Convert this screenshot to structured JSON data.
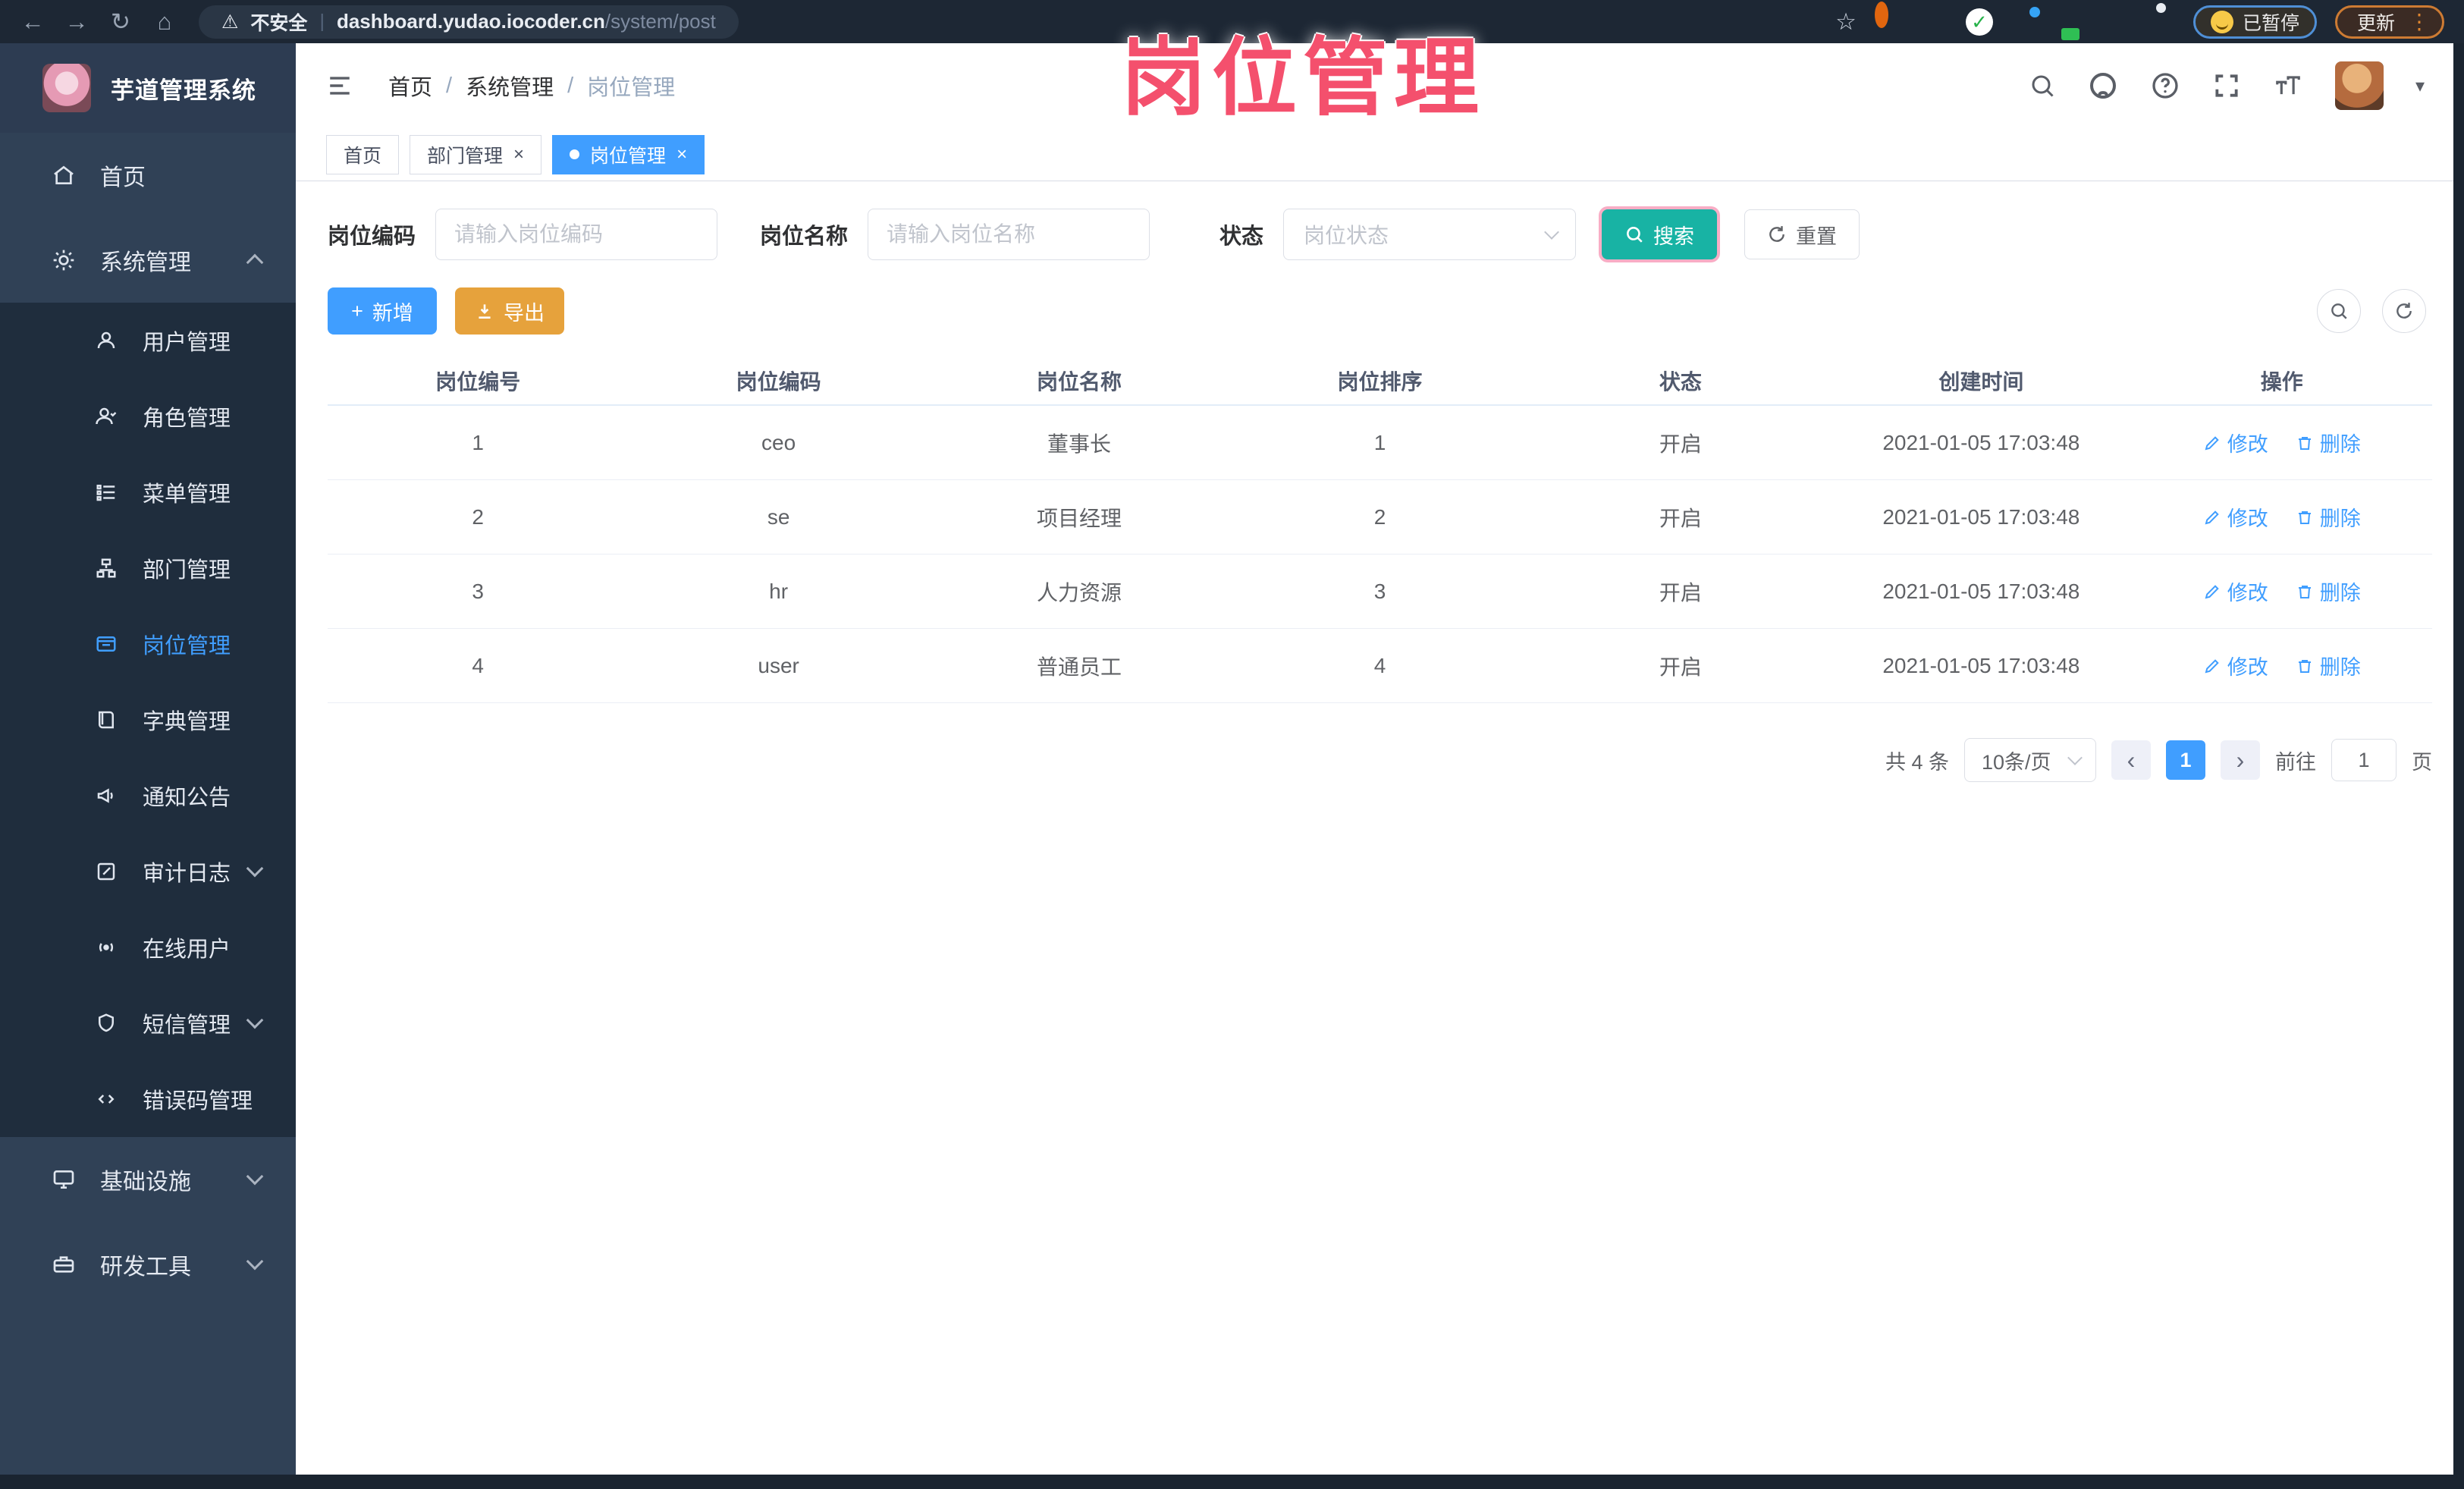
{
  "colors": {
    "accent": "#409EFF",
    "search_teal": "#18b3a4",
    "export_orange": "#E6A23C",
    "overlay_pink": "#f4506d",
    "sidebar_bg": "#304156",
    "submenu_bg": "#1f2d3d"
  },
  "glyphs": {
    "back": "←",
    "forward": "→",
    "reload": "↻",
    "home": "⌂",
    "star": "☆",
    "divider": "|",
    "warning": "⚠",
    "kebab": "⋮",
    "caret_down": "▾",
    "plus": "+",
    "close": "×",
    "prev": "‹",
    "next": "›"
  },
  "browser": {
    "security_label": "不安全",
    "url_host": "dashboard.yudao.iocoder.cn",
    "url_path": "/system/post",
    "paused_label": "已暂停",
    "update_label": "更新"
  },
  "overlay_title": "岗位管理",
  "sidebar": {
    "app_title": "芋道管理系统",
    "items": [
      {
        "label": "首页"
      },
      {
        "label": "系统管理"
      },
      {
        "label": "用户管理"
      },
      {
        "label": "角色管理"
      },
      {
        "label": "菜单管理"
      },
      {
        "label": "部门管理"
      },
      {
        "label": "岗位管理"
      },
      {
        "label": "字典管理"
      },
      {
        "label": "通知公告"
      },
      {
        "label": "审计日志"
      },
      {
        "label": "在线用户"
      },
      {
        "label": "短信管理"
      },
      {
        "label": "错误码管理"
      },
      {
        "label": "基础设施"
      },
      {
        "label": "研发工具"
      }
    ]
  },
  "header": {
    "breadcrumb": [
      "首页",
      "系统管理",
      "岗位管理"
    ],
    "separator": "/"
  },
  "tabs": [
    {
      "label": "首页"
    },
    {
      "label": "部门管理"
    },
    {
      "label": "岗位管理"
    }
  ],
  "filters": {
    "post_code_label": "岗位编码",
    "post_code_placeholder": "请输入岗位编码",
    "post_name_label": "岗位名称",
    "post_name_placeholder": "请输入岗位名称",
    "status_label": "状态",
    "status_placeholder": "岗位状态",
    "search_label": "搜索",
    "reset_label": "重置"
  },
  "toolbar": {
    "add_label": "新增",
    "export_label": "导出"
  },
  "table": {
    "columns": [
      "岗位编号",
      "岗位编码",
      "岗位名称",
      "岗位排序",
      "状态",
      "创建时间",
      "操作"
    ],
    "actions": {
      "edit": "修改",
      "delete": "删除"
    },
    "rows": [
      {
        "id": "1",
        "code": "ceo",
        "name": "董事长",
        "sort": "1",
        "status": "开启",
        "created": "2021-01-05 17:03:48"
      },
      {
        "id": "2",
        "code": "se",
        "name": "项目经理",
        "sort": "2",
        "status": "开启",
        "created": "2021-01-05 17:03:48"
      },
      {
        "id": "3",
        "code": "hr",
        "name": "人力资源",
        "sort": "3",
        "status": "开启",
        "created": "2021-01-05 17:03:48"
      },
      {
        "id": "4",
        "code": "user",
        "name": "普通员工",
        "sort": "4",
        "status": "开启",
        "created": "2021-01-05 17:03:48"
      }
    ]
  },
  "pagination": {
    "total_text": "共 4 条",
    "page_size": "10条/页",
    "current_page": "1",
    "goto_label": "前往",
    "goto_value": "1",
    "page_unit": "页"
  }
}
